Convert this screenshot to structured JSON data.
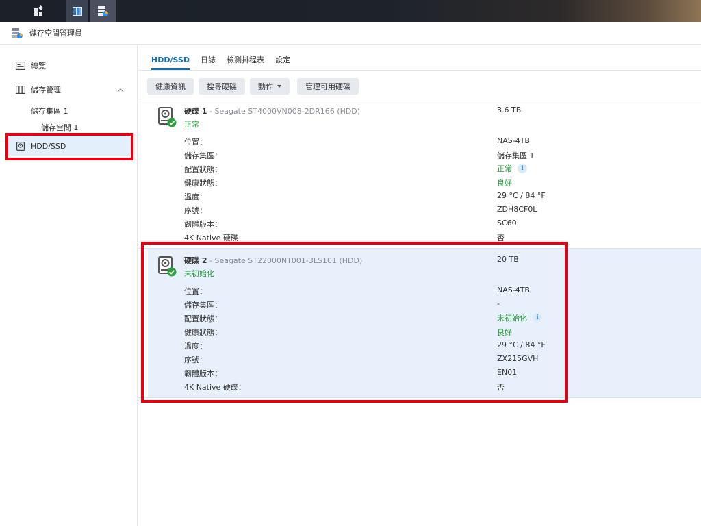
{
  "window": {
    "title": "儲存空間管理員"
  },
  "sidebar": {
    "overview": "總覽",
    "storage": "儲存管理",
    "pool": "儲存集區 1",
    "volume": "儲存空間 1",
    "hdd": "HDD/SSD"
  },
  "tabs": [
    "HDD/SSD",
    "日誌",
    "檢測排程表",
    "設定"
  ],
  "toolbar": {
    "health": "健康資訊",
    "search": "搜尋硬碟",
    "action": "動作",
    "manage": "管理可用硬碟"
  },
  "labels": {
    "location": "位置：",
    "pool": "儲存集區：",
    "alloc": "配置狀態：",
    "health": "健康狀態：",
    "temp": "溫度：",
    "serial": "序號：",
    "firmware": "韌體版本：",
    "native4k": "4K Native 硬碟："
  },
  "disks": [
    {
      "prefix": "硬碟 ",
      "num": "1",
      "model": " - Seagate ST4000VN008-2DR166 (HDD)",
      "status": "正常",
      "capacity": "3.6 TB",
      "location": "NAS-4TB",
      "pool": "儲存集區 1",
      "alloc": "正常",
      "health": "良好",
      "temp": "29 °C / 84 °F",
      "serial": "ZDH8CF0L",
      "firmware": "SC60",
      "native4k": "否"
    },
    {
      "prefix": "硬碟 ",
      "num": "2",
      "model": " - Seagate ST22000NT001-3LS101 (HDD)",
      "status": "未初始化",
      "capacity": "20 TB",
      "location": "NAS-4TB",
      "pool": "-",
      "alloc": "未初始化",
      "health": "良好",
      "temp": "29 °C / 84 °F",
      "serial": "ZX215GVH",
      "firmware": "EN01",
      "native4k": "否"
    }
  ],
  "info_glyph": "i",
  "colors": {
    "accent": "#0f6db8",
    "ok": "#239a3b",
    "highlight": "#e60012",
    "selected": "#e3f0fc"
  }
}
